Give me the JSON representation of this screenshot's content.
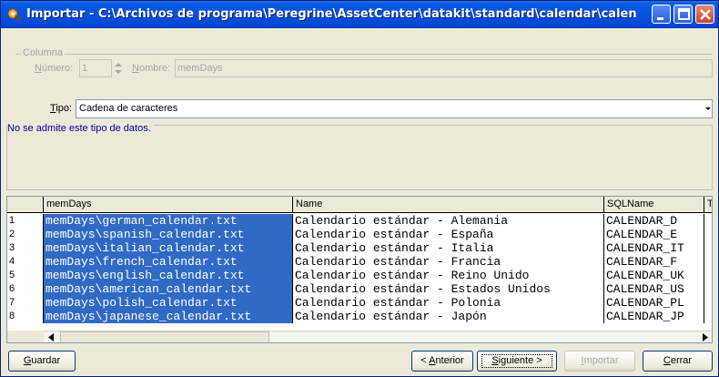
{
  "window": {
    "title": "Importar - C:\\Archivos de programa\\Peregrine\\AssetCenter\\datakit\\standard\\calendar\\calen...",
    "colors": {
      "titlebar": "#0553df",
      "selection": "#316ac5",
      "message": "#0000a0"
    }
  },
  "columna": {
    "legend": "Columna",
    "numero_label_u": "N",
    "numero_label_rest": "úmero:",
    "numero_value": "1",
    "nombre_label_u": "N",
    "nombre_label_rest": "ombre:",
    "nombre_value": "memDays"
  },
  "tipo": {
    "label_u": "T",
    "label_rest": "ipo:",
    "value": "Cadena de caracteres"
  },
  "message": "No se admite este tipo de datos.",
  "grid": {
    "headers": [
      "memDays",
      "Name",
      "SQLName",
      "Ti"
    ],
    "rows": [
      {
        "n": "1",
        "memdays": "memDays\\german_calendar.txt",
        "name": "Calendario estándar - Alemania",
        "sqlname": "CALENDAR_D"
      },
      {
        "n": "2",
        "memdays": "memDays\\spanish_calendar.txt",
        "name": "Calendario estándar - España",
        "sqlname": "CALENDAR_E"
      },
      {
        "n": "3",
        "memdays": "memDays\\italian_calendar.txt",
        "name": "Calendario estándar - Italia",
        "sqlname": "CALENDAR_IT"
      },
      {
        "n": "4",
        "memdays": "memDays\\french_calendar.txt",
        "name": "Calendario estándar - Francia",
        "sqlname": "CALENDAR_F"
      },
      {
        "n": "5",
        "memdays": "memDays\\english_calendar.txt",
        "name": "Calendario estándar - Reino Unido",
        "sqlname": "CALENDAR_UK"
      },
      {
        "n": "6",
        "memdays": "memDays\\american_calendar.txt",
        "name": "Calendario estándar - Estados Unidos",
        "sqlname": "CALENDAR_US"
      },
      {
        "n": "7",
        "memdays": "memDays\\polish_calendar.txt",
        "name": "Calendario estándar - Polonia",
        "sqlname": "CALENDAR_PL"
      },
      {
        "n": "8",
        "memdays": "memDays\\japanese_calendar.txt",
        "name": "Calendario estándar - Japón",
        "sqlname": "CALENDAR_JP"
      }
    ]
  },
  "buttons": {
    "guardar_u": "G",
    "guardar_rest": "uardar",
    "anterior_pre": "< ",
    "anterior_u": "A",
    "anterior_rest": "nterior",
    "siguiente_u": "S",
    "siguiente_rest": "iguiente >",
    "importar_u": "I",
    "importar_rest": "mportar",
    "cerrar_u": "C",
    "cerrar_rest": "errar"
  }
}
